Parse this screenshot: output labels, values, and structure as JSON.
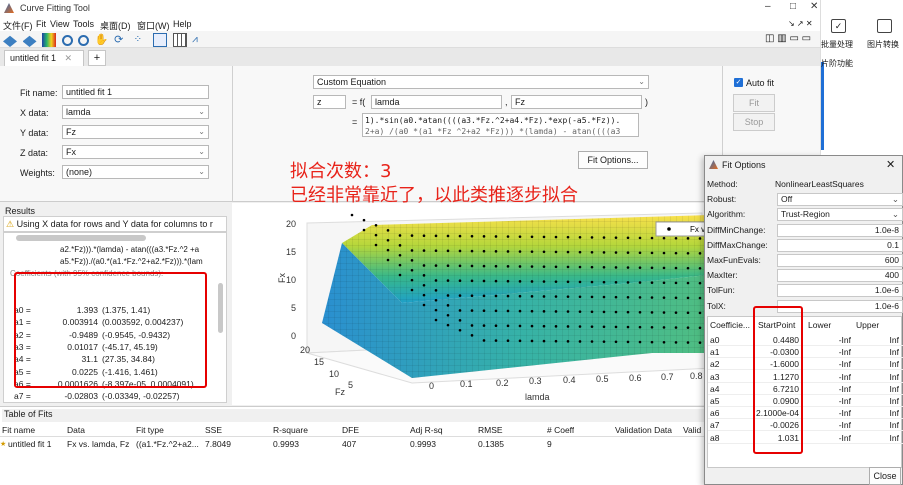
{
  "window": {
    "title": "Curve Fitting Tool",
    "controls": [
      "–",
      "□",
      "✕"
    ]
  },
  "menu": [
    "文件(F)",
    "Fit",
    "View",
    "Tools",
    "桌面(D)",
    "窗口(W)",
    "Help"
  ],
  "tab": {
    "label": "untitled fit 1"
  },
  "form": {
    "fit_name_label": "Fit name:",
    "fit_name": "untitled fit 1",
    "x_label": "X data:",
    "x_value": "lamda",
    "y_label": "Y data:",
    "y_value": "Fz",
    "z_label": "Z data:",
    "z_value": "Fx",
    "w_label": "Weights:",
    "w_value": "(none)"
  },
  "equation": {
    "type": "Custom Equation",
    "lhs": "z",
    "eq": "= f(",
    "var1": "lamda",
    "comma": ",",
    "var2": "Fz",
    "close": ")",
    "rhs_eq": "=",
    "line1": "1).*sin(a0.*atan((((a3.*Fz.^2+a4.*Fz).*exp(-a5.*Fz)).",
    "line2": "2+a) /(a0 *(a1 *Fz ^2+a2 *Fz))) *(lamda) - atan((((a3",
    "options_btn": "Fit Options..."
  },
  "controls": {
    "autofit": "Auto fit",
    "fit": "Fit",
    "stop": "Stop"
  },
  "annotation": {
    "line1": "拟合次数：3",
    "line2": "已经非常靠近了，以此类推逐步拟合"
  },
  "results": {
    "title": "Results",
    "warning": "Using X data for rows and Y data for columns to r",
    "expr1": "a2.*Fz))).*(lamda) - atan(((a3.*Fz.^2 +a",
    "expr2": "a5.*Fz))./(a0.*(a1.*Fz.^2+a2.*Fz))).*(lam",
    "coef_header": "Coefficients (with 95% confidence bounds):",
    "coefs": [
      {
        "name": "a0 =",
        "val": "1.393",
        "ci": "(1.375, 1.41)"
      },
      {
        "name": "a1 =",
        "val": "0.003914",
        "ci": "(0.003592, 0.004237)"
      },
      {
        "name": "a2 =",
        "val": "-0.9489",
        "ci": "(-0.9545, -0.9432)"
      },
      {
        "name": "a3 =",
        "val": "0.01017",
        "ci": "(-45.17, 45.19)"
      },
      {
        "name": "a4 =",
        "val": "31.1",
        "ci": "(27.35, 34.84)"
      },
      {
        "name": "a5 =",
        "val": "0.0225",
        "ci": "(-1.416, 1.461)"
      },
      {
        "name": "a6 =",
        "val": "0.0001626",
        "ci": "(-8.397e-05, 0.0004091)"
      },
      {
        "name": "a7 =",
        "val": "-0.02803",
        "ci": "(-0.03349, -0.02257)"
      },
      {
        "name": "a8 =",
        "val": "1.104",
        "ci": "(1.088, 1.12)"
      }
    ]
  },
  "plot": {
    "zlabel": "Fx",
    "ylabel": "Fz",
    "xlabel": "lamda",
    "legend": "Fx v",
    "zticks": [
      "20",
      "15",
      "10",
      "5",
      "0"
    ],
    "yticks": [
      "20",
      "15",
      "10",
      "5"
    ],
    "xticks": [
      "0",
      "0.1",
      "0.2",
      "0.3",
      "0.4",
      "0.5",
      "0.6",
      "0.7",
      "0.8"
    ]
  },
  "table": {
    "title": "Table of Fits",
    "headers": [
      "Fit name",
      "Data",
      "Fit type",
      "SSE",
      "R-square",
      "DFE",
      "Adj R-sq",
      "RMSE",
      "# Coeff",
      "Validation Data",
      "Valid"
    ],
    "row": [
      "untitled fit 1",
      "Fx vs. lamda, Fz",
      "((a1.*Fz.^2+a2...",
      "7.8049",
      "0.9993",
      "407",
      "0.9993",
      "0.1385",
      "9",
      "",
      ""
    ]
  },
  "fit_options": {
    "title": "Fit Options",
    "rows": [
      {
        "label": "Method:",
        "value": "NonlinearLeastSquares",
        "kind": "text"
      },
      {
        "label": "Robust:",
        "value": "Off",
        "kind": "dd"
      },
      {
        "label": "Algorithm:",
        "value": "Trust-Region",
        "kind": "dd"
      },
      {
        "label": "DiffMinChange:",
        "value": "1.0e-8",
        "kind": "field"
      },
      {
        "label": "DiffMaxChange:",
        "value": "0.1",
        "kind": "field"
      },
      {
        "label": "MaxFunEvals:",
        "value": "600",
        "kind": "field"
      },
      {
        "label": "MaxIter:",
        "value": "400",
        "kind": "field"
      },
      {
        "label": "TolFun:",
        "value": "1.0e-6",
        "kind": "field"
      },
      {
        "label": "TolX:",
        "value": "1.0e-6",
        "kind": "field"
      }
    ],
    "coef_headers": [
      "Coefficie...",
      "StartPoint",
      "Lower",
      "Upper"
    ],
    "coef_rows": [
      {
        "name": "a0",
        "start": "0.4480",
        "lower": "-Inf",
        "upper": "Inf"
      },
      {
        "name": "a1",
        "start": "-0.0300",
        "lower": "-Inf",
        "upper": "Inf"
      },
      {
        "name": "a2",
        "start": "-1.6000",
        "lower": "-Inf",
        "upper": "Inf"
      },
      {
        "name": "a3",
        "start": "1.1270",
        "lower": "-Inf",
        "upper": "Inf"
      },
      {
        "name": "a4",
        "start": "6.7210",
        "lower": "-Inf",
        "upper": "Inf"
      },
      {
        "name": "a5",
        "start": "0.0900",
        "lower": "-Inf",
        "upper": "Inf"
      },
      {
        "name": "a6",
        "start": "2.1000e-04",
        "lower": "-Inf",
        "upper": "Inf"
      },
      {
        "name": "a7",
        "start": "-0.0026",
        "lower": "-Inf",
        "upper": "Inf"
      },
      {
        "name": "a8",
        "start": "1.031",
        "lower": "-Inf",
        "upper": "Inf"
      }
    ],
    "close": "Close"
  },
  "right_app": {
    "item1": "批量处理",
    "item2": "图片转换",
    "item3": "片阶功能"
  }
}
